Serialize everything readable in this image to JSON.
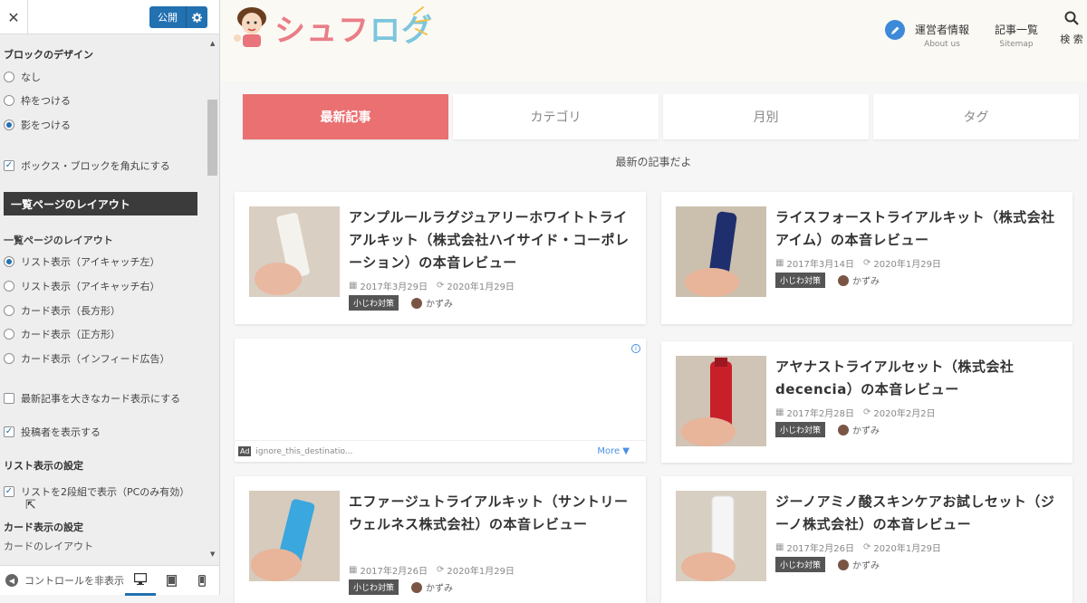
{
  "customizer": {
    "close_label": "✕",
    "publish_label": "公開",
    "block_design_heading": "ブロックのデザイン",
    "block_options": [
      "なし",
      "枠をつける",
      "影をつける"
    ],
    "block_selected": 2,
    "rounded_label": "ボックス・ブロックを角丸にする",
    "rounded_checked": true,
    "section_title": "一覧ページのレイアウト",
    "layout_heading": "一覧ページのレイアウト",
    "layout_options": [
      "リスト表示（アイキャッチ左）",
      "リスト表示（アイキャッチ右）",
      "カード表示（長方形）",
      "カード表示（正方形）",
      "カード表示（インフィード広告）"
    ],
    "layout_selected": 0,
    "big_card_label": "最新記事を大きなカード表示にする",
    "big_card_checked": false,
    "show_author_label": "投稿者を表示する",
    "show_author_checked": true,
    "list_settings_heading": "リスト表示の設定",
    "two_col_label": "リストを2段組で表示（PCのみ有効）",
    "two_col_checked": true,
    "card_settings_heading": "カード表示の設定",
    "card_layout_label": "カードのレイアウト",
    "hide_controls_label": "コントロールを非表示",
    "devices": [
      "desktop-icon",
      "tablet-icon",
      "mobile-icon"
    ]
  },
  "site": {
    "logo_part1": "シュフ",
    "logo_part2": "ログ",
    "nav": [
      {
        "main": "運営者情報",
        "sub": "About us"
      },
      {
        "main": "記事一覧",
        "sub": "Sitemap"
      }
    ],
    "search_label": "検 索",
    "tabs": [
      "最新記事",
      "カテゴリ",
      "月別",
      "タグ"
    ],
    "active_tab": 0,
    "tabs_caption": "最新の記事だよ",
    "posts": [
      {
        "title": "アンプルールラグジュアリーホワイトトライアルキット（株式会社ハイサイド・コーポレーション）の本音レビュー",
        "date": "2017年3月29日",
        "updated": "2020年1月29日",
        "category": "小じわ対策",
        "author": "かずみ",
        "thumb_color": "#e8e2d8"
      },
      {
        "title": "ライスフォーストライアルキット（株式会社アイム）の本音レビュー",
        "date": "2017年3月14日",
        "updated": "2020年1月29日",
        "category": "小じわ対策",
        "author": "かずみ",
        "thumb_color": "#1f2f6e"
      },
      {
        "title": "アヤナストライアルセット（株式会社decencia）の本音レビュー",
        "date": "2017年2月28日",
        "updated": "2020年2月2日",
        "category": "小じわ対策",
        "author": "かずみ",
        "thumb_color": "#c8202a"
      },
      {
        "title": "エファージュトライアルキット（サントリーウェルネス株式会社）の本音レビュー",
        "date": "2017年2月26日",
        "updated": "2020年1月29日",
        "category": "小じわ対策",
        "author": "かずみ",
        "thumb_color": "#3aa7de"
      },
      {
        "title": "ジーノアミノ酸スキンケアお試しセット（ジーノ株式会社）の本音レビュー",
        "date": "2017年2月26日",
        "updated": "2020年1月29日",
        "category": "小じわ対策",
        "author": "かずみ",
        "thumb_color": "#f0f0f0"
      }
    ],
    "ad": {
      "badge": "Ad",
      "text": "ignore_this_destinatio...",
      "more": "More ▼"
    }
  }
}
